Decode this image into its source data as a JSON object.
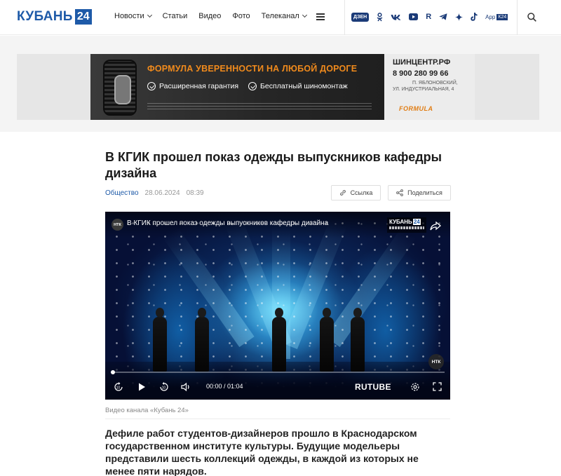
{
  "header": {
    "logo_text": "КУБАНЬ",
    "logo_number": "24",
    "nav": [
      {
        "label": "Новости",
        "dropdown": true
      },
      {
        "label": "Статьи",
        "dropdown": false
      },
      {
        "label": "Видео",
        "dropdown": false
      },
      {
        "label": "Фото",
        "dropdown": false
      },
      {
        "label": "Телеканал",
        "dropdown": true
      }
    ],
    "socials": {
      "dzen": "ДЗЕН",
      "ok": "ok-icon",
      "vk": "vk-icon",
      "youtube": "youtube-icon",
      "rutube": "R",
      "telegram": "telegram-icon",
      "sparkle": "sparkle-icon",
      "tiktok": "tiktok-icon",
      "app_label": "App",
      "app_badge": "К24"
    },
    "search_icon": "search-icon"
  },
  "ad": {
    "headline": "ФОРМУЛА УВЕРЕННОСТИ НА ЛЮБОЙ ДОРОГЕ",
    "features": [
      "Расширенная гарантия",
      "Бесплатный шиномонтаж"
    ],
    "site": "ШИНЦЕНТР.РФ",
    "phone": "8 900 280 99 66",
    "address_line1": "П. ЯБЛОНОВСКИЙ,",
    "address_line2": "УЛ. ИНДУСТРИАЛЬНАЯ, 4",
    "brand": "FORMULA"
  },
  "article": {
    "title": "В КГИК прошел показ одежды выпускников кафедры дизайна",
    "category": "Общество",
    "date": "28.06.2024",
    "time": "08:39",
    "link_button": "Ссылка",
    "share_button": "Поделиться",
    "video": {
      "channel_badge": "НТК",
      "title": "В КГИК прошел показ одежды выпускников кафедры дизайна",
      "channel_logo": "КУБАНЬ",
      "channel_logo_num": "24",
      "time": "00:00 / 01:04",
      "progress": 0,
      "player_brand": "RUTUBE"
    },
    "caption": "Видео канала «Кубань 24»",
    "lead": "Дефиле работ студентов-дизайнеров прошло в Краснодарском государственном институте культуры. Будущие модельеры представили шесть коллекций одежды, в каждой из которых не менее пяти нарядов."
  },
  "colors": {
    "brand_blue": "#1e5aa8",
    "ad_orange": "#f08a1c",
    "social_navy": "#1b3b78"
  }
}
